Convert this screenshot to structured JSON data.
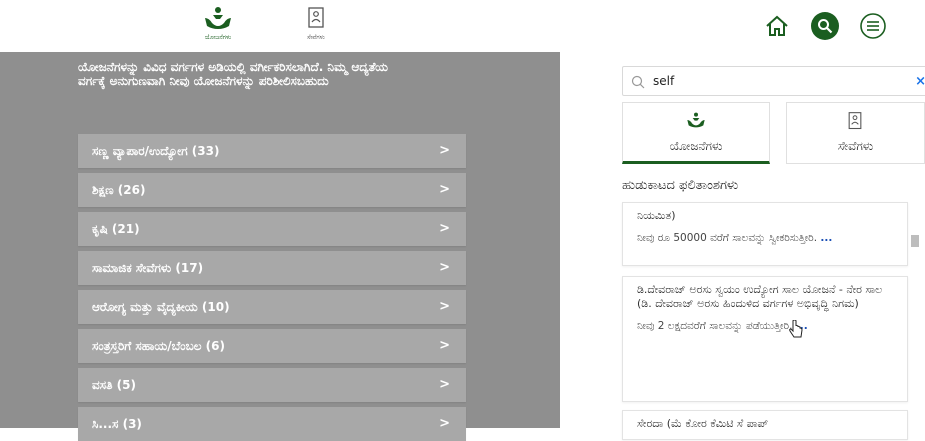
{
  "header": {
    "tabs": [
      {
        "label": "ಯೋಜನೆಗಳು",
        "icon": "hands-heart-icon",
        "active": true
      },
      {
        "label": "ಸೇವೆಗಳು",
        "icon": "document-person-icon",
        "active": false
      }
    ],
    "icons": [
      "home-icon",
      "search-icon",
      "menu-icon"
    ],
    "accent": "#1b5e20"
  },
  "left": {
    "intro": "ಯೋಜನೆಗಳನ್ನು ವಿವಿಧ ವರ್ಗಗಳ ಅಡಿಯಲ್ಲಿ ವರ್ಗೀಕರಿಸಲಾಗಿದೆ. ನಿಮ್ಮ ಆದ್ಯತೆಯ ವರ್ಗಕ್ಕೆ ಅನುಗುಣವಾಗಿ ನೀವು ಯೋಜನೆಗಳನ್ನು ಪರಿಶೀಲಿಸಬಹುದು",
    "categories": [
      {
        "label": "ಸಣ್ಣ ವ್ಯಾಪಾರ/ಉದ್ಯೋಗ (33)",
        "arrow": ">"
      },
      {
        "label": "ಶಿಕ್ಷಣ (26)",
        "arrow": ">"
      },
      {
        "label": "ಕೃಷಿ (21)",
        "arrow": ">"
      },
      {
        "label": "ಸಾಮಾಜಿಕ ಸೇವೆಗಳು (17)",
        "arrow": ">"
      },
      {
        "label": "ಆರೋಗ್ಯ ಮತ್ತು ವೈದ್ಯಕೀಯ (10)",
        "arrow": ">"
      },
      {
        "label": "ಸಂತ್ರಸ್ತರಿಗೆ ಸಹಾಯ/ಬೆಂಬಲ (6)",
        "arrow": ">"
      },
      {
        "label": "ವಸತಿ (5)",
        "arrow": ">"
      },
      {
        "label": "ಸಿ...ಸ (3)",
        "arrow": ">"
      }
    ]
  },
  "right": {
    "search": {
      "value": "self",
      "clear": "×"
    },
    "tabs": [
      {
        "label": "ಯೋಜನೆಗಳು",
        "active": true
      },
      {
        "label": "ಸೇವೆಗಳು",
        "active": false
      }
    ],
    "results_title": "ಹುಡುಕಾಟದ ಫಲಿತಾಂಶಗಳು",
    "cards": [
      {
        "title": "ನಿಯಮಿತ)",
        "desc": "ನೀವು ರೂ 50000 ವರೆಗೆ ಸಾಲವನ್ನು ಸ್ವೀಕರಿಸುತ್ತೀರಿ.",
        "more": "..."
      },
      {
        "title": "ಡಿ.ದೇವರಾಜ್ ಅರಸು ಸ್ವಯಂ ಉದ್ಯೋಗ ಸಾಲ ಯೋಜನೆ - ನೇರ ಸಾಲ (ಡಿ. ದೇವರಾಜ್ ಅರಸು ಹಿಂದುಳಿದ ವರ್ಗಗಳ ಅಭಿವೃದ್ಧಿ ನಿಗಮ)",
        "desc": "ನೀವು 2 ಲಕ್ಷದವರೆಗೆ ಸಾಲವನ್ನು ಪಡೆಯುತ್ತೀರಿ.",
        "more": "..."
      },
      {
        "title": "ಸೇರದಾ (ಮೆ ಕೋರ ಕೆಮಿಟಿ ಸೆ ಪಾಪ್",
        "desc": "",
        "more": ""
      }
    ]
  }
}
